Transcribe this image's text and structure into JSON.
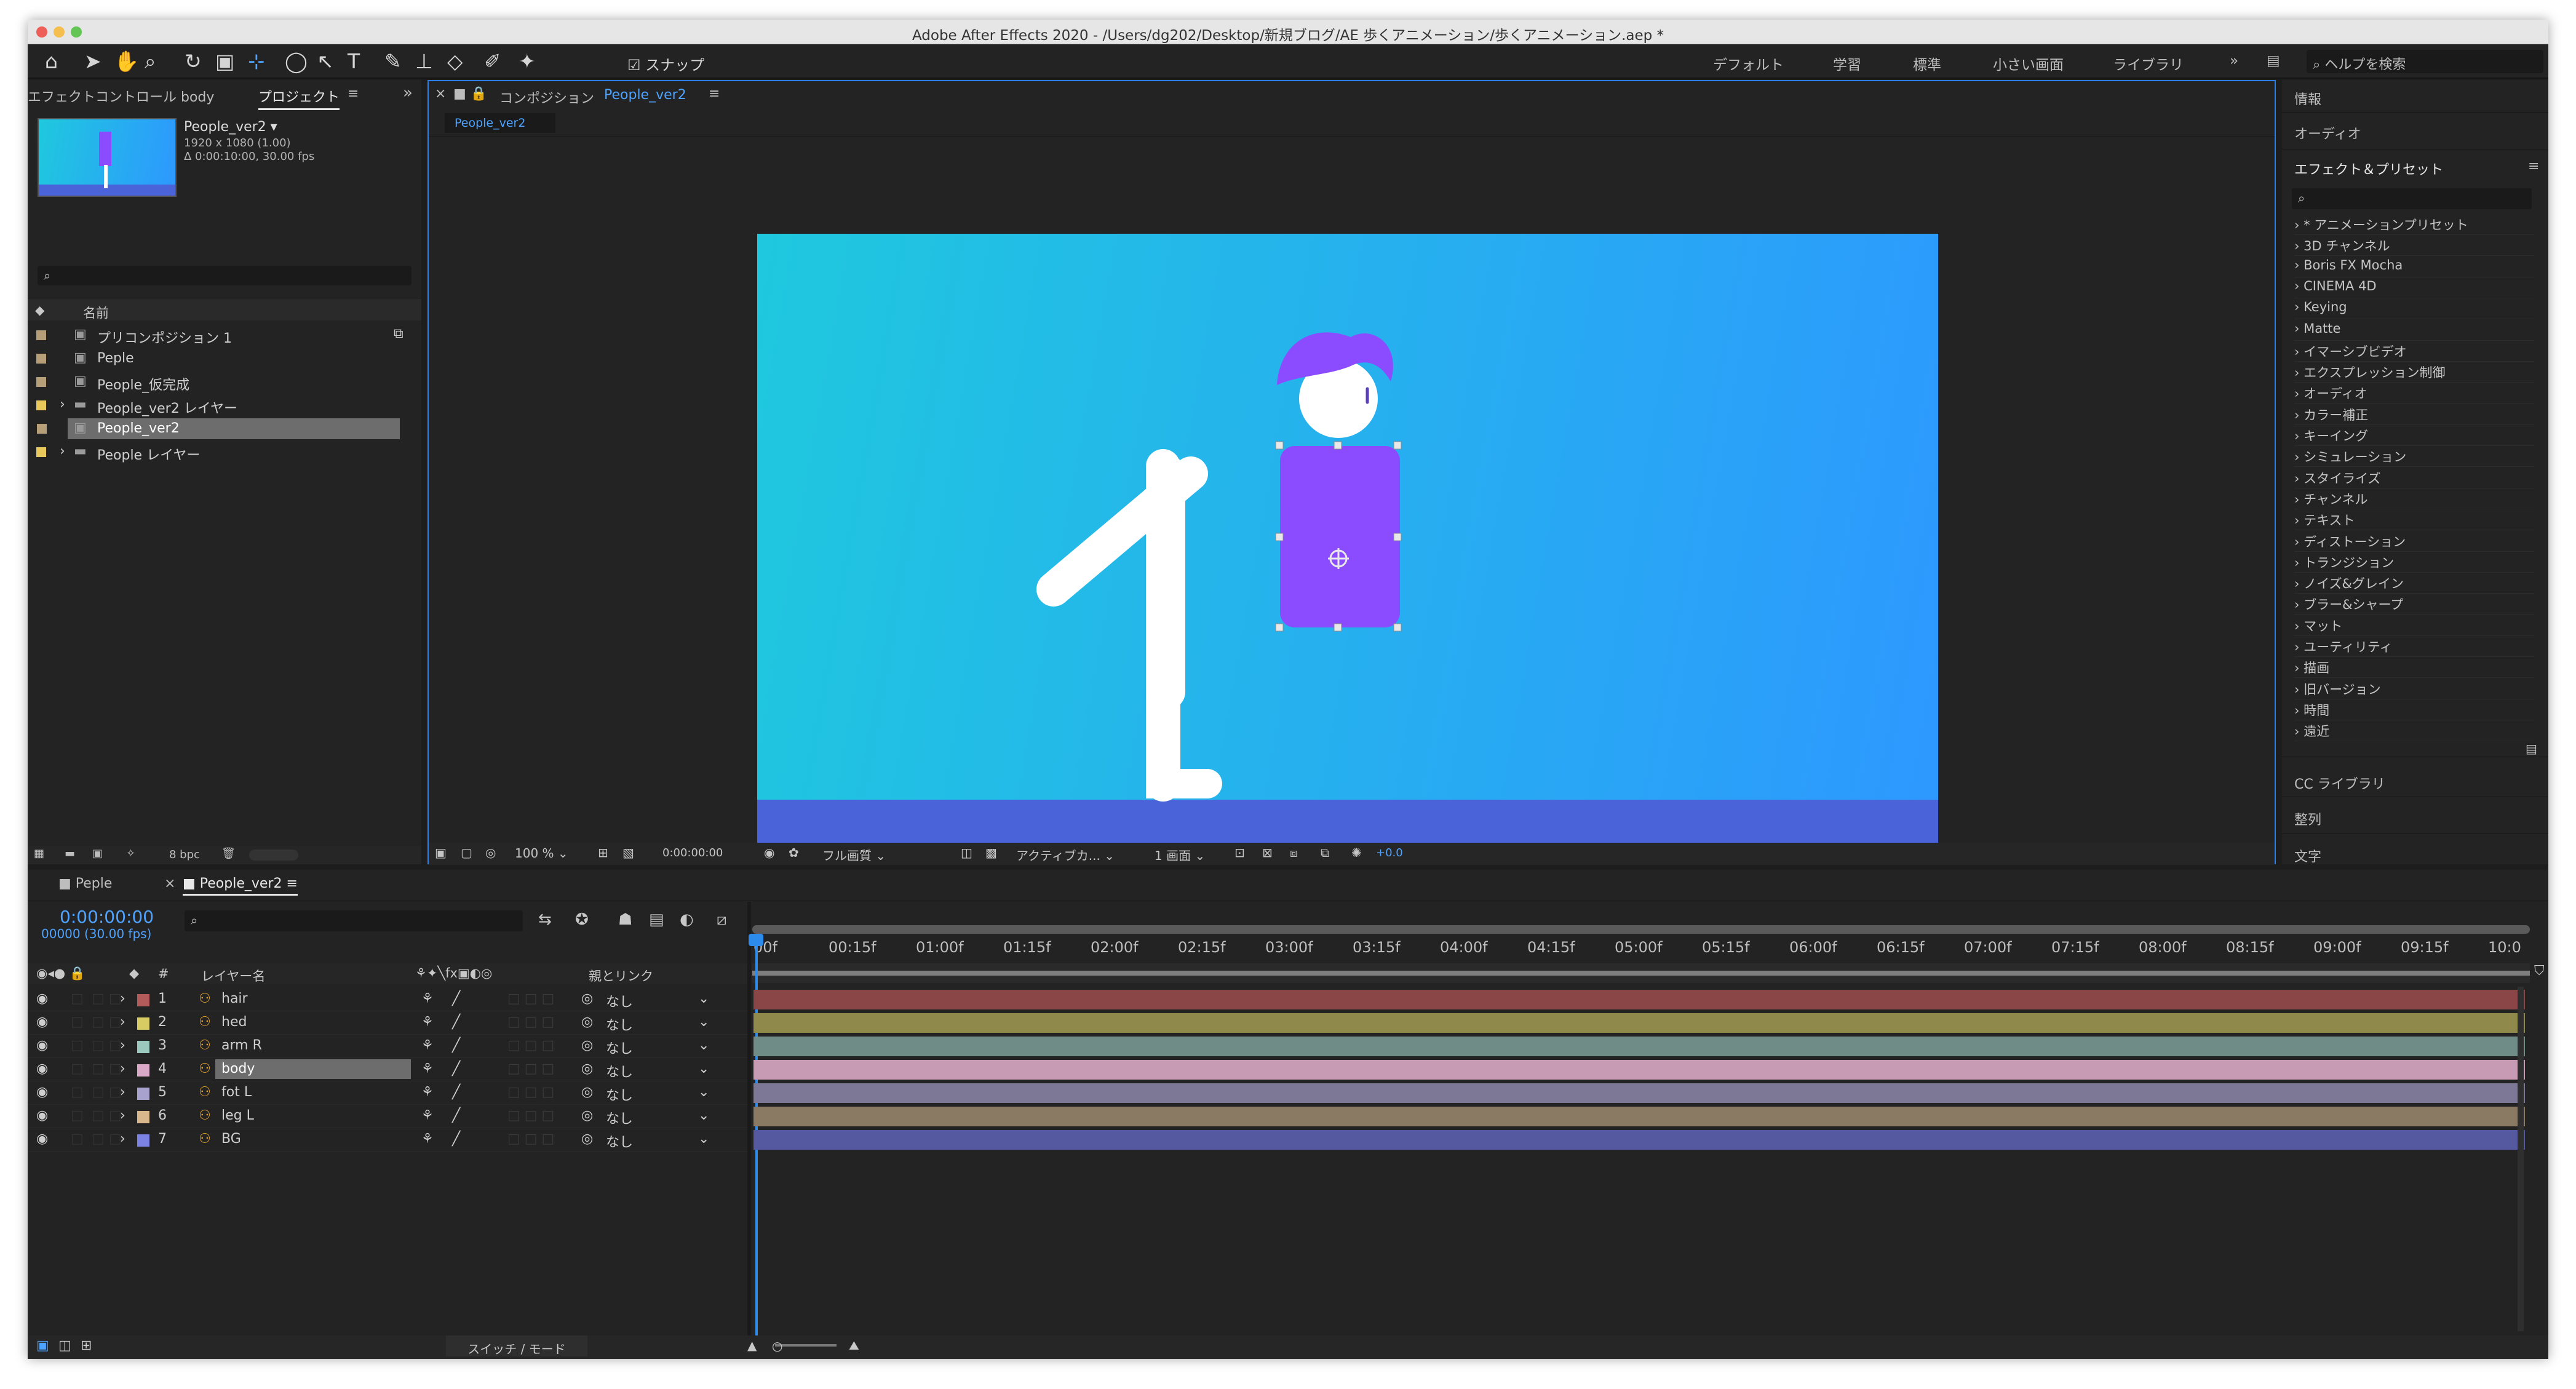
{
  "window": {
    "title": "Adobe After Effects 2020 - /Users/dg202/Desktop/新規ブログ/AE 歩くアニメーション/歩くアニメーション.aep *"
  },
  "toolbar": {
    "snap_label": "スナップ",
    "workspaces": [
      "デフォルト",
      "学習",
      "標準",
      "小さい画面",
      "ライブラリ"
    ],
    "search_placeholder": "ヘルプを検索"
  },
  "left_panel": {
    "tabs": [
      "エフェクトコントロール body",
      "プロジェクト"
    ],
    "thumb_info": {
      "name": "People_ver2 ▾",
      "size": "1920 x 1080 (1.00)",
      "duration": "Δ 0:00:10:00, 30.00 fps"
    },
    "column_name": "名前",
    "items": [
      {
        "name": "プリコンポジション 1",
        "type": "comp",
        "color": "#b59e78"
      },
      {
        "name": "Peple",
        "type": "comp",
        "color": "#b59e78"
      },
      {
        "name": "People_仮完成",
        "type": "comp",
        "color": "#b59e78"
      },
      {
        "name": "People_ver2 レイヤー",
        "type": "folder",
        "color": "#e8c85a"
      },
      {
        "name": "People_ver2",
        "type": "comp",
        "color": "#b59e78",
        "selected": true
      },
      {
        "name": "People レイヤー",
        "type": "folder",
        "color": "#e8c85a"
      }
    ],
    "bpc": "8 bpc"
  },
  "comp_panel": {
    "tab_label": "コンポジション",
    "tab_name": "People_ver2",
    "sub_tab": "People_ver2",
    "zoom": "100 %",
    "timecode": "0:00:00:00",
    "quality": "フル画質",
    "camera": "アクティブカ...",
    "views": "1 画面",
    "exposure": "+0.0"
  },
  "right_panel": {
    "sections": [
      "情報",
      "オーディオ"
    ],
    "effects_title": "エフェクト＆プリセット",
    "effects": [
      "* アニメーションプリセット",
      "3D チャンネル",
      "Boris FX Mocha",
      "CINEMA 4D",
      "Keying",
      "Matte",
      "イマーシブビデオ",
      "エクスプレッション制御",
      "オーディオ",
      "カラー補正",
      "キーイング",
      "シミュレーション",
      "スタイライズ",
      "チャンネル",
      "テキスト",
      "ディストーション",
      "トランジション",
      "ノイズ&グレイン",
      "ブラー&シャープ",
      "マット",
      "ユーティリティ",
      "描画",
      "旧バージョン",
      "時間",
      "遠近"
    ],
    "bottom_sections": [
      "CC ライブラリ",
      "整列",
      "文字"
    ]
  },
  "timeline": {
    "tabs": [
      "Peple",
      "People_ver2"
    ],
    "timecode": "0:00:00:00",
    "frames": "00000 (30.00 fps)",
    "col_num": "#",
    "col_name": "レイヤー名",
    "col_parent": "親とリンク",
    "ticks": [
      "00f",
      "00:15f",
      "01:00f",
      "01:15f",
      "02:00f",
      "02:15f",
      "03:00f",
      "03:15f",
      "04:00f",
      "04:15f",
      "05:00f",
      "05:15f",
      "06:00f",
      "06:15f",
      "07:00f",
      "07:15f",
      "08:00f",
      "08:15f",
      "09:00f",
      "09:15f",
      "10:0"
    ],
    "layers": [
      {
        "num": "1",
        "name": "hair",
        "color": "#b35b5b",
        "bar": "#8a4646",
        "parent": "なし"
      },
      {
        "num": "2",
        "name": "hed",
        "color": "#d7cc63",
        "bar": "#8f8a4c",
        "parent": "なし"
      },
      {
        "num": "3",
        "name": "arm R",
        "color": "#9cc9be",
        "bar": "#6f8c87",
        "parent": "なし"
      },
      {
        "num": "4",
        "name": "body",
        "color": "#dba9c8",
        "bar": "#c79bb4",
        "parent": "なし",
        "selected": true
      },
      {
        "num": "5",
        "name": "fot L",
        "color": "#a8a2cf",
        "bar": "#7c7896",
        "parent": "なし"
      },
      {
        "num": "6",
        "name": "leg L",
        "color": "#d8b78c",
        "bar": "#8b7a63",
        "parent": "なし"
      },
      {
        "num": "7",
        "name": "BG",
        "color": "#7b82e3",
        "bar": "#5459a0",
        "parent": "なし"
      }
    ],
    "switch_mode": "スイッチ / モード"
  },
  "colors": {
    "canvas_from": "#1fc8de",
    "canvas_to": "#2d98ff",
    "ground": "#4a63d8",
    "character": "#8b4cff",
    "accent": "#2d8ceb"
  }
}
